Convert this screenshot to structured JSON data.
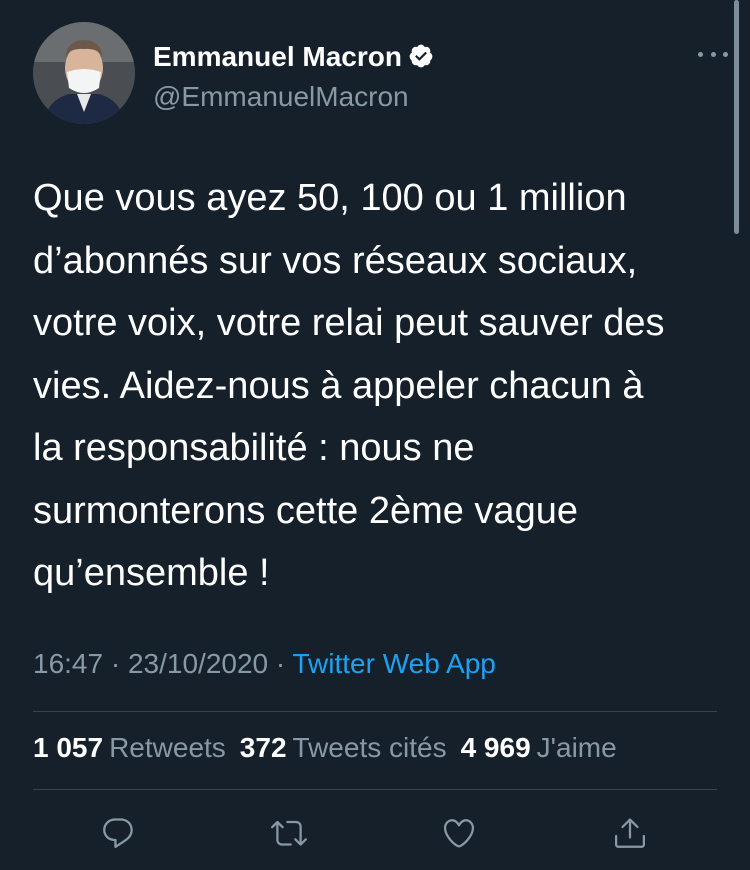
{
  "author": {
    "display_name": "Emmanuel Macron",
    "handle": "@EmmanuelMacron",
    "verified_icon": "verified-badge-icon"
  },
  "tweet": {
    "text": "Que vous ayez 50, 100 ou 1 million\nd’abonnés sur vos réseaux sociaux,\nvotre voix, votre relai peut sauver des\nvies. Aidez-nous à appeler chacun à\nla responsabilité : nous ne\nsurmonterons cette 2ème vague\nqu’ensemble !",
    "time": "16:47",
    "separator": " · ",
    "date": "23/10/2020",
    "source": "Twitter Web App"
  },
  "stats": {
    "retweets_count": "1 057",
    "retweets_label": "Retweets",
    "quotes_count": "372",
    "quotes_label": "Tweets cités",
    "likes_count": "4 969",
    "likes_label": "J'aime"
  },
  "actions": {
    "reply_icon": "reply-icon",
    "retweet_icon": "retweet-icon",
    "like_icon": "heart-icon",
    "share_icon": "share-icon"
  },
  "colors": {
    "background": "#15202b",
    "text": "#ffffff",
    "secondary": "#8899a6",
    "link": "#1da1f2",
    "divider": "#38444d"
  }
}
